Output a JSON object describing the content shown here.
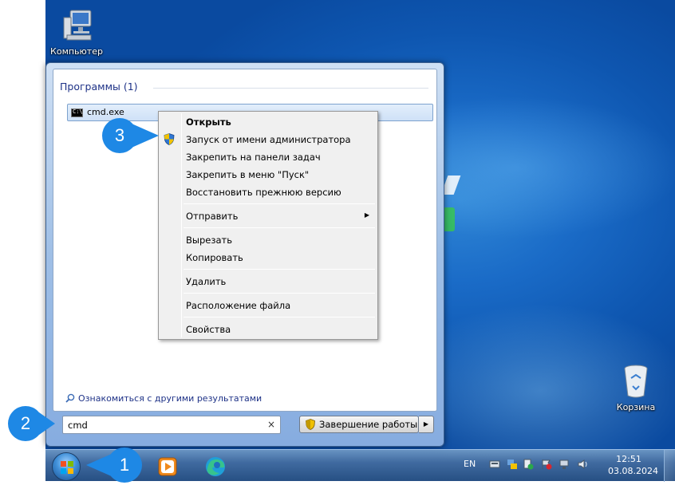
{
  "desktop": {
    "icons": [
      {
        "label": "Компьютер",
        "icon": "computer-icon"
      },
      {
        "label": "Корзина",
        "icon": "recycle-bin-icon"
      }
    ]
  },
  "start_menu": {
    "group_title": "Программы (1)",
    "result_label": "cmd.exe",
    "result_icon": "cmd-icon",
    "more_results": "Ознакомиться с другими результатами",
    "search_value": "cmd",
    "search_clear": "×",
    "shutdown_label": "Завершение работы",
    "shutdown_arrow": "▶"
  },
  "context_menu": {
    "items": [
      {
        "label": "Открыть",
        "bold": true
      },
      {
        "label": "Запуск от имени администратора",
        "icon": "uac-shield-icon"
      },
      {
        "label": "Закрепить на панели задач"
      },
      {
        "label": "Закрепить в меню \"Пуск\""
      },
      {
        "label": "Восстановить прежнюю версию"
      },
      {
        "label": "Отправить",
        "submenu": true
      },
      {
        "label": "Вырезать"
      },
      {
        "label": "Копировать"
      },
      {
        "label": "Удалить"
      },
      {
        "label": "Расположение файла"
      },
      {
        "label": "Свойства"
      }
    ],
    "submenu_arrow": "▶"
  },
  "taskbar": {
    "apps": [
      "media-player-icon",
      "edge-icon"
    ],
    "lang": "EN",
    "time": "12:51",
    "date": "03.08.2024"
  },
  "callouts": {
    "step1": "1",
    "step2": "2",
    "step3": "3"
  },
  "colors": {
    "callout": "#1e88e5",
    "link": "#1e3287"
  }
}
